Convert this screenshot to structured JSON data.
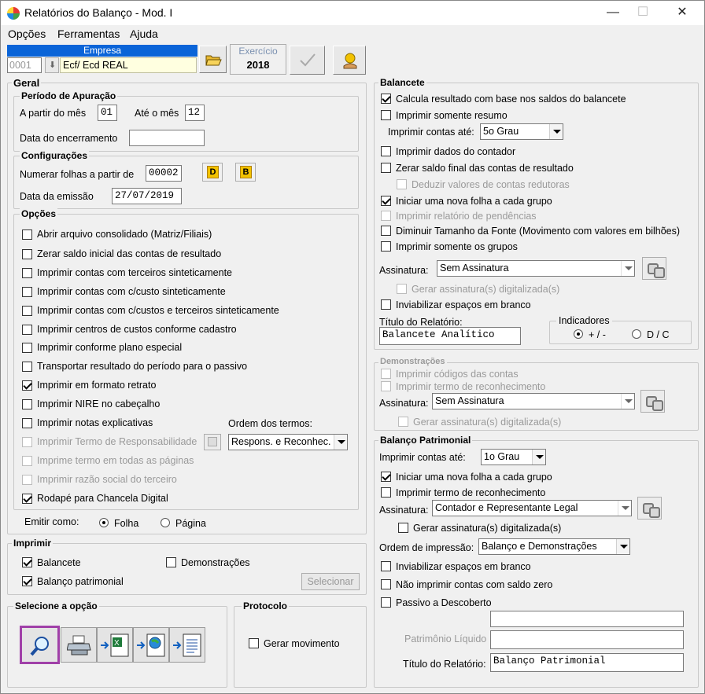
{
  "window": {
    "title": "Relatórios do Balanço - Mod. I",
    "minimize": "—",
    "maximize": "☐",
    "close": "✕"
  },
  "menu": [
    "Opções",
    "Ferramentas",
    "Ajuda"
  ],
  "header": {
    "empresa_label": "Empresa",
    "empresa_code": "0001",
    "empresa_name": "Ecf/ Ecd REAL",
    "exercicio_label": "Exercício",
    "exercicio_value": "2018",
    "icons": [
      "folder-open-icon",
      "checkmark-icon",
      "coin-hand-icon"
    ]
  },
  "geral": {
    "title": "Geral",
    "periodo": {
      "title": "Período de Apuração",
      "from_label": "A partir do mês",
      "from_value": "01",
      "to_label": "Até o mês",
      "to_value": "12",
      "encerramento_label": "Data do encerramento",
      "encerramento_value": ""
    },
    "config": {
      "title": "Configurações",
      "numerar_label": "Numerar folhas a partir de",
      "numerar_value": "00002",
      "btn_d": "D",
      "btn_b": "B",
      "emissao_label": "Data da emissão",
      "emissao_value": "27/07/2019"
    },
    "opcoes": {
      "title": "Opções",
      "items": [
        {
          "label": "Abrir arquivo consolidado (Matriz/Filiais)",
          "checked": false,
          "disabled": false
        },
        {
          "label": "Zerar saldo inicial das contas de resultado",
          "checked": false,
          "disabled": false
        },
        {
          "label": "Imprimir contas com terceiros sinteticamente",
          "checked": false,
          "disabled": false
        },
        {
          "label": "Imprimir contas com c/custo sinteticamente",
          "checked": false,
          "disabled": false
        },
        {
          "label": "Imprimir contas com c/custos e terceiros sinteticamente",
          "checked": false,
          "disabled": false
        },
        {
          "label": "Imprimir centros de custos conforme cadastro",
          "checked": false,
          "disabled": false
        },
        {
          "label": "Imprimir conforme plano especial",
          "checked": false,
          "disabled": false
        },
        {
          "label": "Transportar resultado do período para o passivo",
          "checked": false,
          "disabled": false
        },
        {
          "label": "Imprimir em formato retrato",
          "checked": true,
          "disabled": false
        },
        {
          "label": "Imprimir NIRE no cabeçalho",
          "checked": false,
          "disabled": false
        },
        {
          "label": "Imprimir notas explicativas",
          "checked": false,
          "disabled": false
        },
        {
          "label": "Imprimir Termo de Responsabilidade",
          "checked": false,
          "disabled": true
        },
        {
          "label": "Imprime termo em todas as páginas",
          "checked": false,
          "disabled": true
        },
        {
          "label": "Imprimir razão social do terceiro",
          "checked": false,
          "disabled": true
        },
        {
          "label": "Rodapé para Chancela Digital",
          "checked": true,
          "disabled": false
        }
      ],
      "ordem_label": "Ordem dos termos:",
      "ordem_value": "Respons. e Reconhec."
    },
    "emitir_label": "Emitir como:",
    "emitir_options": [
      "Folha",
      "Página"
    ],
    "emitir_selected": "Folha"
  },
  "imprimir": {
    "title": "Imprimir",
    "balancete": "Balancete",
    "balancete_checked": true,
    "demonstracoes": "Demonstrações",
    "demonstracoes_checked": false,
    "balanco": "Balanço patrimonial",
    "balanco_checked": true,
    "selecionar": "Selecionar"
  },
  "selecione": {
    "title": "Selecione a opção",
    "icons": [
      "magnifier-preview-icon",
      "printer-icon",
      "excel-export-icon",
      "web-export-icon",
      "document-export-icon"
    ]
  },
  "protocolo": {
    "title": "Protocolo",
    "gerar": "Gerar movimento",
    "gerar_checked": false
  },
  "balancete": {
    "title": "Balancete",
    "calcula": "Calcula resultado com base nos saldos do balancete",
    "calcula_checked": true,
    "resumo": "Imprimir somente resumo",
    "resumo_checked": false,
    "imprimir_contas_label": "Imprimir contas até:",
    "imprimir_contas_value": "5o Grau",
    "contador": "Imprimir dados do contador",
    "zerar": "Zerar saldo final das contas de resultado",
    "deduzir": "Deduzir valores de contas redutoras",
    "nova_folha": "Iniciar uma nova folha a cada grupo",
    "nova_folha_checked": true,
    "pendencias": "Imprimir relatório de pendências",
    "diminuir": "Diminuir Tamanho da Fonte (Movimento com valores em bilhões)",
    "grupos": "Imprimir somente os grupos",
    "assinatura_label": "Assinatura:",
    "assinatura_value": "Sem Assinatura",
    "gerar_assinatura": "Gerar assinatura(s) digitalizada(s)",
    "inviabilizar": "Inviabilizar espaços em branco",
    "titulo_label": "Título do Relatório:",
    "titulo_value": "Balancete Analítico",
    "indicadores_title": "Indicadores",
    "indicadores_options": [
      "+ / -",
      "D / C"
    ],
    "indicadores_selected": "+ / -"
  },
  "demonstracoes": {
    "title": "Demonstrações",
    "codigos": "Imprimir códigos das contas",
    "termo": "Imprimir termo de reconhecimento",
    "assinatura_label": "Assinatura:",
    "assinatura_value": "Sem Assinatura",
    "gerar_assinatura": "Gerar assinatura(s) digitalizada(s)"
  },
  "balanco": {
    "title": "Balanço Patrimonial",
    "imprimir_contas_label": "Imprimir contas até:",
    "imprimir_contas_value": "1o Grau",
    "nova_folha": "Iniciar uma nova folha a cada grupo",
    "nova_folha_checked": true,
    "termo": "Imprimir termo de reconhecimento",
    "assinatura_label": "Assinatura:",
    "assinatura_value": "Contador e Representante Legal",
    "gerar_assinatura": "Gerar assinatura(s) digitalizada(s)",
    "ordem_label": "Ordem de impressão:",
    "ordem_value": "Balanço e Demonstrações",
    "inviabilizar": "Inviabilizar espaços em branco",
    "nao_imprimir": "Não imprimir contas com saldo zero",
    "passivo": "Passivo a Descoberto",
    "passivo_field": "",
    "patrimonio_label": "Patrimônio Líquido",
    "patrimonio_value": "",
    "titulo_label": "Título do Relatório:",
    "titulo_value": "Balanço Patrimonial"
  }
}
